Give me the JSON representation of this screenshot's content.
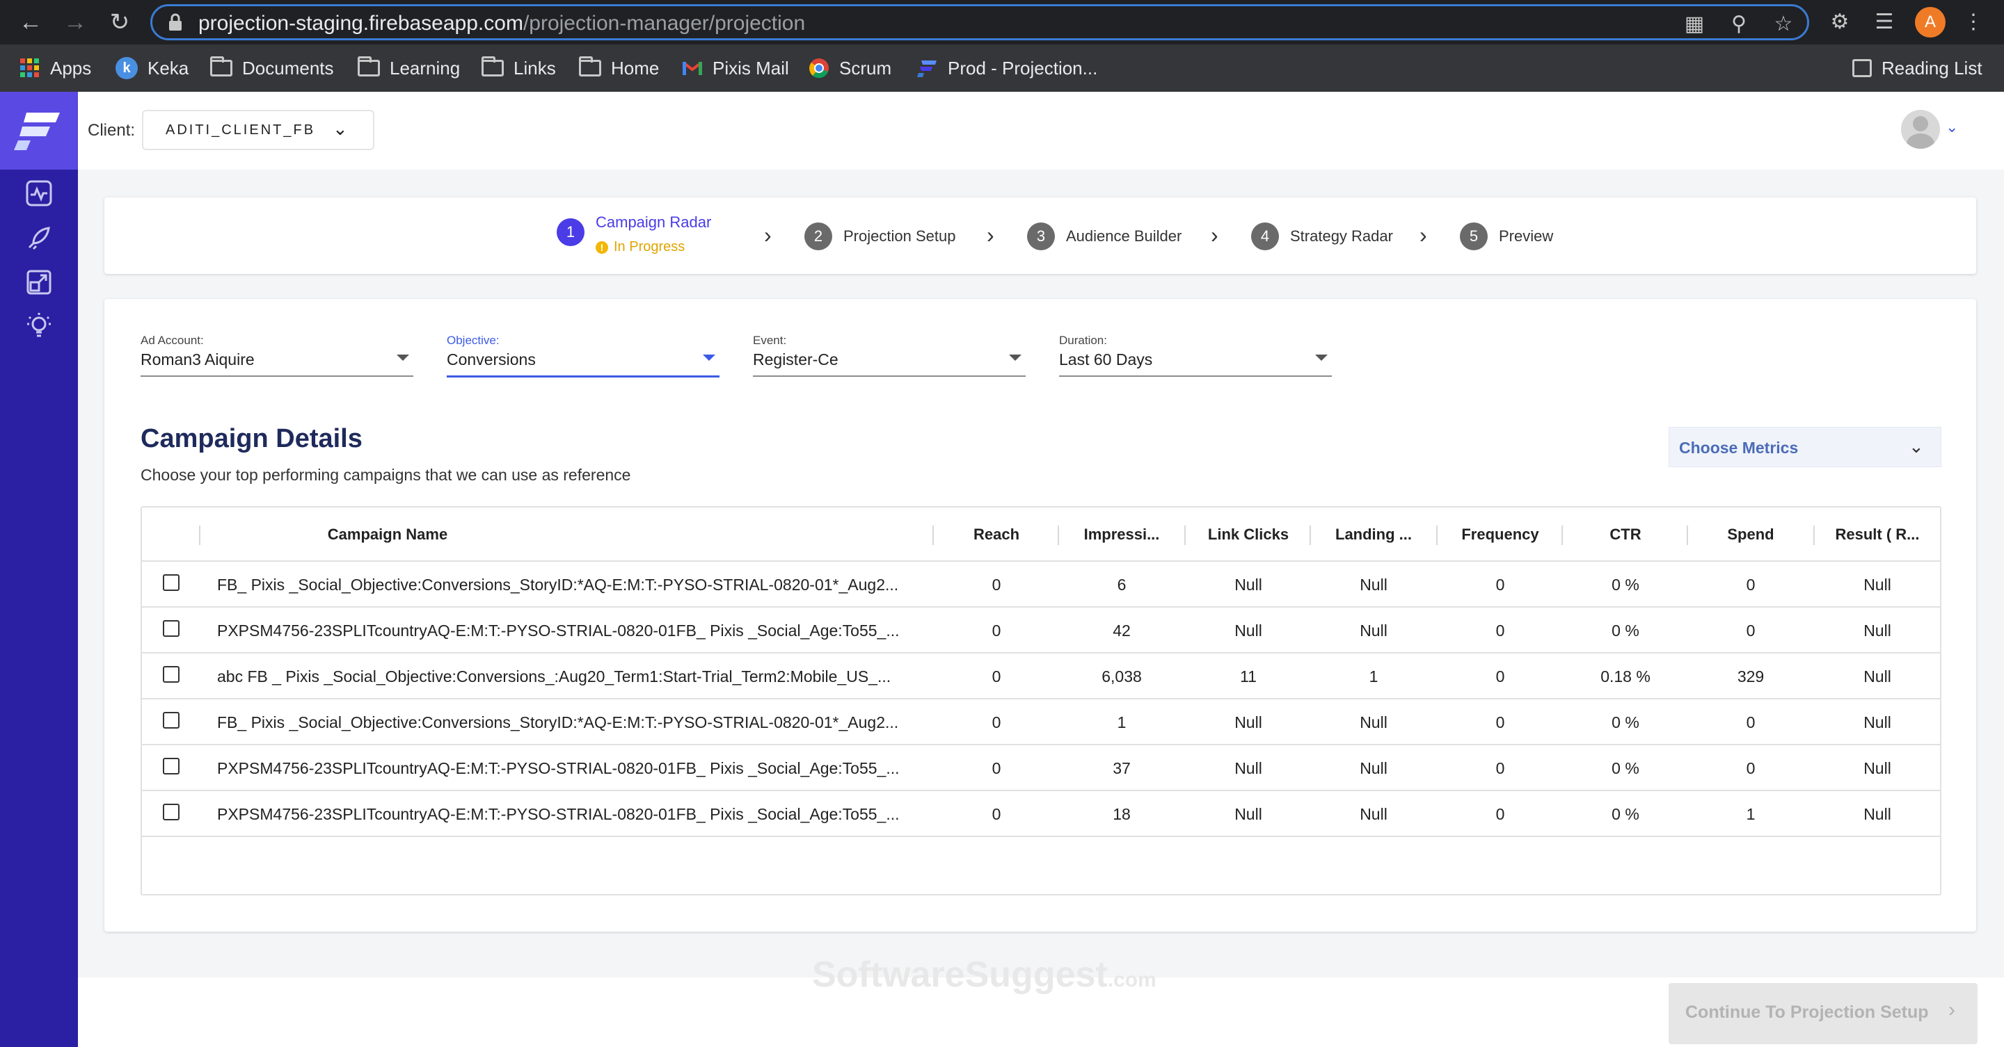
{
  "browser": {
    "url_host": "projection-staging.firebaseapp.com",
    "url_path": "/projection-manager/projection",
    "profile_initial": "A",
    "bookmarks": [
      {
        "label": "Apps",
        "icon": "apps-grid-icon"
      },
      {
        "label": "Keka",
        "icon": "keka-icon"
      },
      {
        "label": "Documents",
        "icon": "folder-icon"
      },
      {
        "label": "Learning",
        "icon": "folder-icon"
      },
      {
        "label": "Links",
        "icon": "folder-icon"
      },
      {
        "label": "Home",
        "icon": "folder-icon"
      },
      {
        "label": "Pixis Mail",
        "icon": "gmail-icon"
      },
      {
        "label": "Scrum",
        "icon": "chrome-icon"
      },
      {
        "label": "Prod - Projection...",
        "icon": "projection-logo-icon"
      }
    ],
    "reading_list": "Reading List"
  },
  "topbar": {
    "client_label": "Client:",
    "client_value": "ADITI_CLIENT_FB"
  },
  "stepper": {
    "steps": [
      {
        "number": "1",
        "label": "Campaign Radar",
        "status": "In Progress"
      },
      {
        "number": "2",
        "label": "Projection Setup"
      },
      {
        "number": "3",
        "label": "Audience Builder"
      },
      {
        "number": "4",
        "label": "Strategy Radar"
      },
      {
        "number": "5",
        "label": "Preview"
      }
    ]
  },
  "filters": {
    "ad_account": {
      "label": "Ad Account:",
      "value": "Roman3 Aiquire"
    },
    "objective": {
      "label": "Objective:",
      "value": "Conversions"
    },
    "event": {
      "label": "Event:",
      "value": "Register-Ce"
    },
    "duration": {
      "label": "Duration:",
      "value": "Last 60 Days"
    }
  },
  "campaign_details": {
    "title": "Campaign Details",
    "subtitle": "Choose your top performing campaigns that we can use as reference",
    "choose_metrics": "Choose Metrics"
  },
  "table": {
    "columns": [
      "Campaign Name",
      "Reach",
      "Impressi...",
      "Link Clicks",
      "Landing ...",
      "Frequency",
      "CTR",
      "Spend",
      "Result ( R..."
    ],
    "rows": [
      {
        "name": "FB_ Pixis _Social_Objective:Conversions_StoryID:*AQ-E:M:T:-PYSO-STRIAL-0820-01*_Aug2...",
        "reach": "0",
        "impressions": "6",
        "link_clicks": "Null",
        "landing": "Null",
        "frequency": "0",
        "ctr": "0 %",
        "spend": "0",
        "result": "Null"
      },
      {
        "name": "PXPSM4756-23SPLITcountryAQ-E:M:T:-PYSO-STRIAL-0820-01FB_ Pixis _Social_Age:To55_...",
        "reach": "0",
        "impressions": "42",
        "link_clicks": "Null",
        "landing": "Null",
        "frequency": "0",
        "ctr": "0 %",
        "spend": "0",
        "result": "Null"
      },
      {
        "name": "abc FB _ Pixis _Social_Objective:Conversions_:Aug20_Term1:Start-Trial_Term2:Mobile_US_...",
        "reach": "0",
        "impressions": "6,038",
        "link_clicks": "11",
        "landing": "1",
        "frequency": "0",
        "ctr": "0.18 %",
        "spend": "329",
        "result": "Null"
      },
      {
        "name": "FB_ Pixis _Social_Objective:Conversions_StoryID:*AQ-E:M:T:-PYSO-STRIAL-0820-01*_Aug2...",
        "reach": "0",
        "impressions": "1",
        "link_clicks": "Null",
        "landing": "Null",
        "frequency": "0",
        "ctr": "0 %",
        "spend": "0",
        "result": "Null"
      },
      {
        "name": "PXPSM4756-23SPLITcountryAQ-E:M:T:-PYSO-STRIAL-0820-01FB_ Pixis _Social_Age:To55_...",
        "reach": "0",
        "impressions": "37",
        "link_clicks": "Null",
        "landing": "Null",
        "frequency": "0",
        "ctr": "0 %",
        "spend": "0",
        "result": "Null"
      },
      {
        "name": "PXPSM4756-23SPLITcountryAQ-E:M:T:-PYSO-STRIAL-0820-01FB_ Pixis _Social_Age:To55_...",
        "reach": "0",
        "impressions": "18",
        "link_clicks": "Null",
        "landing": "Null",
        "frequency": "0",
        "ctr": "0 %",
        "spend": "1",
        "result": "Null"
      }
    ]
  },
  "footer": {
    "continue_label": "Continue To Projection Setup",
    "watermark": "SoftwareSuggest",
    "watermark_suffix": ".com"
  },
  "colors": {
    "sidebar": "#2b20a3",
    "accent": "#4a3ce6",
    "status_in_progress": "#e0a500",
    "title": "#1f2a5c"
  }
}
